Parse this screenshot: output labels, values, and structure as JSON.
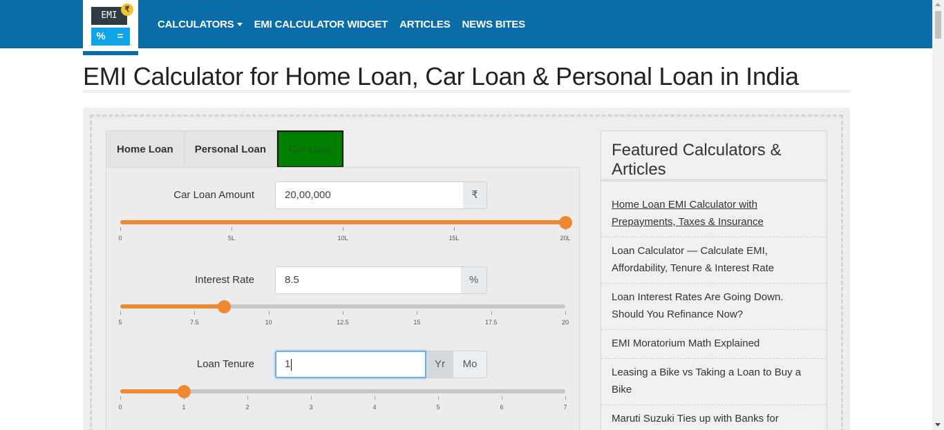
{
  "header": {
    "logo": {
      "screen_text": "EMI",
      "coin_symbol": "₹",
      "key1": "%",
      "key2": "="
    },
    "nav": [
      {
        "label": "CALCULATORS",
        "has_dropdown": true
      },
      {
        "label": "EMI CALCULATOR WIDGET"
      },
      {
        "label": "ARTICLES"
      },
      {
        "label": "NEWS BITES"
      }
    ],
    "brand_color": "#0b6da8"
  },
  "page": {
    "title": "EMI Calculator for Home Loan, Car Loan & Personal Loan in India"
  },
  "tabs": [
    {
      "label": "Home Loan",
      "active": false
    },
    {
      "label": "Personal Loan",
      "active": false
    },
    {
      "label": "Car Loan",
      "active": true
    }
  ],
  "form": {
    "amount": {
      "label": "Car Loan Amount",
      "value": "20,00,000",
      "unit": "₹",
      "slider_fraction": 1.0,
      "ticks": [
        "0",
        "5L",
        "10L",
        "15L",
        "20L"
      ]
    },
    "interest": {
      "label": "Interest Rate",
      "value": "8.5",
      "unit": "%",
      "slider_fraction": 0.2333,
      "ticks": [
        "5",
        "7.5",
        "10",
        "12.5",
        "15",
        "17.5",
        "20"
      ]
    },
    "tenure": {
      "label": "Loan Tenure",
      "value": "1",
      "unit_year": "Yr",
      "unit_month": "Mo",
      "slider_fraction": 0.1429,
      "ticks": [
        "0",
        "1",
        "2",
        "3",
        "4",
        "5",
        "6",
        "7"
      ]
    }
  },
  "featured": {
    "title": "Featured Calculators & Articles",
    "items": [
      {
        "label": "Home Loan EMI Calculator with Prepayments, Taxes & Insurance",
        "link": true
      },
      {
        "label": "Loan Calculator — Calculate EMI, Affordability, Tenure & Interest Rate",
        "link": false
      },
      {
        "label": "Loan Interest Rates Are Going Down. Should You Refinance Now?",
        "link": false
      },
      {
        "label": "EMI Moratorium Math Explained",
        "link": false
      },
      {
        "label": "Leasing a Bike vs Taking a Loan to Buy a Bike",
        "link": false
      },
      {
        "label": "Maruti Suzuki Ties up with Banks for",
        "link": false
      }
    ]
  },
  "colors": {
    "slider_fill": "#f0882f",
    "active_tab": "#008000",
    "focus_border": "#66afe9"
  }
}
